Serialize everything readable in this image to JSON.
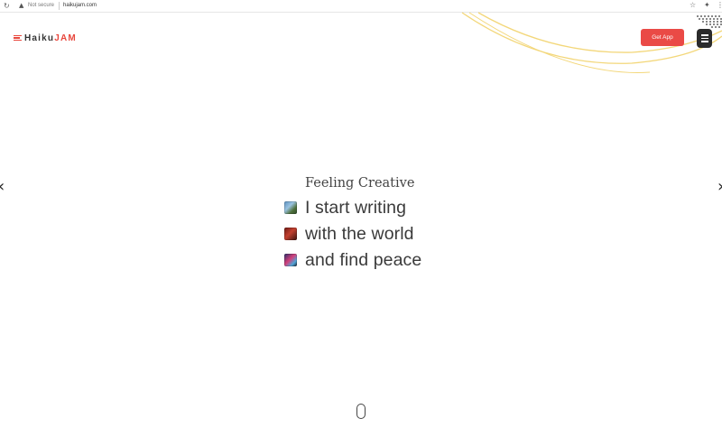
{
  "browser": {
    "security_text": "Not secure",
    "url": "haikujam.com",
    "icons": [
      "reload-icon",
      "warning-icon",
      "star-icon",
      "extensions-icon",
      "more-icon"
    ]
  },
  "header": {
    "logo_text_main": "Haiku",
    "logo_text_accent": "JAM",
    "get_app_label": "Get App",
    "menu_icon": "hamburger-icon"
  },
  "colors": {
    "accent": "#ea4a46",
    "menu_bg": "#2b2b2b",
    "arc": "#f3d77a"
  },
  "hero": {
    "heading": "Feeling Creative",
    "lines": [
      {
        "text": "I start writing",
        "thumb": "landscape-thumbnail"
      },
      {
        "text": "with the world",
        "thumb": "red-art-thumbnail"
      },
      {
        "text": "and find peace",
        "thumb": "colorful-art-thumbnail"
      }
    ]
  },
  "navigation": {
    "prev_icon": "chevron-left-icon",
    "next_icon": "chevron-right-icon",
    "scroll_icon": "mouse-scroll-icon"
  }
}
